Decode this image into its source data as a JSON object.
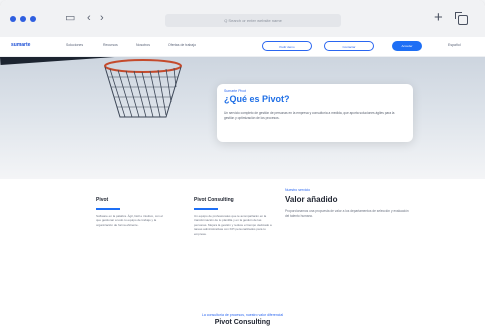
{
  "browser": {
    "address_text": "Q  Search or enter website name",
    "plus_label": "+",
    "back_label": "‹",
    "forward_label": "›",
    "sidebar_icon": "sidebar-icon"
  },
  "site": {
    "logo": "sumarte",
    "nav": [
      "Soluciones",
      "Recursos",
      "Nosotros",
      "Ofertas de trabajo"
    ],
    "cta_outline_1": "Pedir demo",
    "cta_outline_2": "Contactar",
    "cta_solid": "Acceder",
    "lang": "Español"
  },
  "hero": {
    "eyebrow": "Sumarte Pivot",
    "title": "¿Qué es Pivot?",
    "body": "Un servicio completo de gestión de personas en la empresa y consultoría a medida, que aporta soluciones ágiles para la gestión y optimización de los procesos."
  },
  "features": [
    {
      "title": "Pivot",
      "body": "Software en la palabra. Ágil, fácil e intuitivo, con el que gestionar a todo tu equipo de trabajo y la organización de forma eficiente."
    },
    {
      "title": "Pivot Consulting",
      "body": "Un equipo de profesionales que te acompañarán en la transformación de tu plantilla y en la gestión de las personas. Mejora la gestión y reduce el tiempo dedicado a tareas administrativas con KPI personalizados para tu empresa."
    }
  ],
  "value": {
    "eyebrow": "Nuestro servicio",
    "title": "Valor añadido",
    "body": "Proporcionamos una propuesta de valor a los departamentos de selección y evaluación del talento humano."
  },
  "bottom": {
    "eyebrow": "La consultoría de procesos, nuestro valor diferencial",
    "title": "Pivot Consulting"
  },
  "colors": {
    "brand": "#1e6ff5",
    "hero_title": "#1f6fe6"
  }
}
